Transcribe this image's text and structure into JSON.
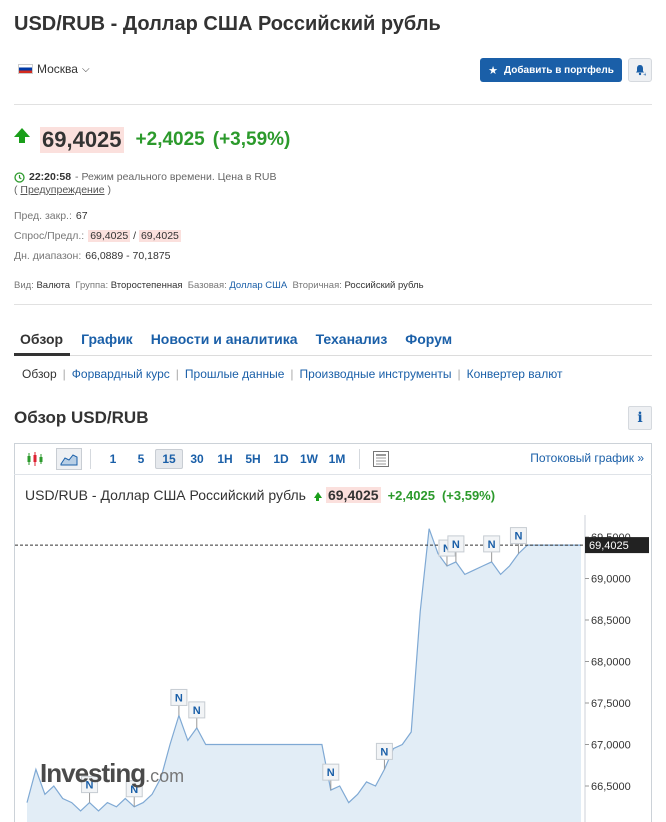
{
  "header": {
    "title": "USD/RUB - Доллар США Российский рубль",
    "location": "Москва",
    "add_portfolio": "Добавить в портфель"
  },
  "quote": {
    "price": "69,4025",
    "change": "+2,4025",
    "change_pct": "(+3,59%)",
    "time": "22:20:58",
    "status_text": "- Режим реального времени.  Цена в RUB",
    "warning": "Предупреждение",
    "prev_close_label": "Пред. закр.:",
    "prev_close": "67",
    "bid_ask_label": "Спрос/Предл.:",
    "bid": "69,4025",
    "ask": "69,4025",
    "range_label": "Дн. диапазон:",
    "range": "66,0889 - 70,1875"
  },
  "meta": {
    "type_label": "Вид:",
    "type": "Валюта",
    "group_label": "Группа:",
    "group": "Второстепенная",
    "base_label": "Базовая:",
    "base": "Доллар США",
    "second_label": "Вторичная:",
    "second": "Российский рубль"
  },
  "tabs": [
    "Обзор",
    "График",
    "Новости и аналитика",
    "Теханализ",
    "Форум"
  ],
  "subtabs": [
    "Обзор",
    "Форвардный курс",
    "Прошлые данные",
    "Производные инструменты",
    "Конвертер валют"
  ],
  "overview_title": "Обзор USD/RUB",
  "info_label": "i",
  "toolbar": {
    "timeframes": [
      "1",
      "5",
      "15",
      "30",
      "1H",
      "5H",
      "1D",
      "1W",
      "1M"
    ],
    "active_timeframe": "15",
    "stream": "Потоковый график »"
  },
  "chart_head": {
    "title": "USD/RUB - Доллар США Российский рубль",
    "price": "69,4025",
    "change": "+2,4025",
    "change_pct": "(+3,59%)"
  },
  "watermark": {
    "brand": "Investing",
    "suffix": ".com"
  },
  "chart_data": {
    "type": "area",
    "y_ticks": [
      "69,5000",
      "69,0000",
      "68,5000",
      "68,0000",
      "67,5000",
      "67,0000",
      "66,5000"
    ],
    "y_values": [
      69.5,
      69.0,
      68.5,
      68.0,
      67.5,
      67.0,
      66.5
    ],
    "ylim": [
      66.2,
      69.9
    ],
    "current_price_label": "69,4025",
    "current_price": 69.4025,
    "series_y": [
      66.3,
      66.7,
      66.4,
      66.5,
      66.35,
      66.3,
      66.2,
      66.3,
      66.2,
      66.3,
      66.25,
      66.35,
      66.25,
      66.3,
      66.4,
      66.6,
      67.0,
      67.35,
      67.05,
      67.2,
      67.0,
      67.0,
      67.0,
      67.0,
      67.0,
      67.0,
      67.0,
      67.0,
      67.0,
      67.0,
      67.0,
      67.0,
      67.0,
      67.0,
      66.45,
      66.5,
      66.3,
      66.4,
      66.55,
      66.5,
      66.7,
      66.95,
      67.0,
      67.15,
      68.6,
      69.6,
      69.3,
      69.15,
      69.2,
      69.05,
      69.1,
      69.15,
      69.2,
      69.05,
      69.15,
      69.3,
      69.4025,
      69.4025,
      69.4025,
      69.4025,
      69.4025,
      69.4025,
      69.4025
    ],
    "markers": [
      {
        "label": "N",
        "i": 7
      },
      {
        "label": "N",
        "i": 12
      },
      {
        "label": "N",
        "i": 17
      },
      {
        "label": "N",
        "i": 19
      },
      {
        "label": "N",
        "i": 34
      },
      {
        "label": "N",
        "i": 40
      },
      {
        "label": "N",
        "i": 47
      },
      {
        "label": "N",
        "i": 48
      },
      {
        "label": "N",
        "i": 52
      },
      {
        "label": "N",
        "i": 55
      }
    ]
  }
}
